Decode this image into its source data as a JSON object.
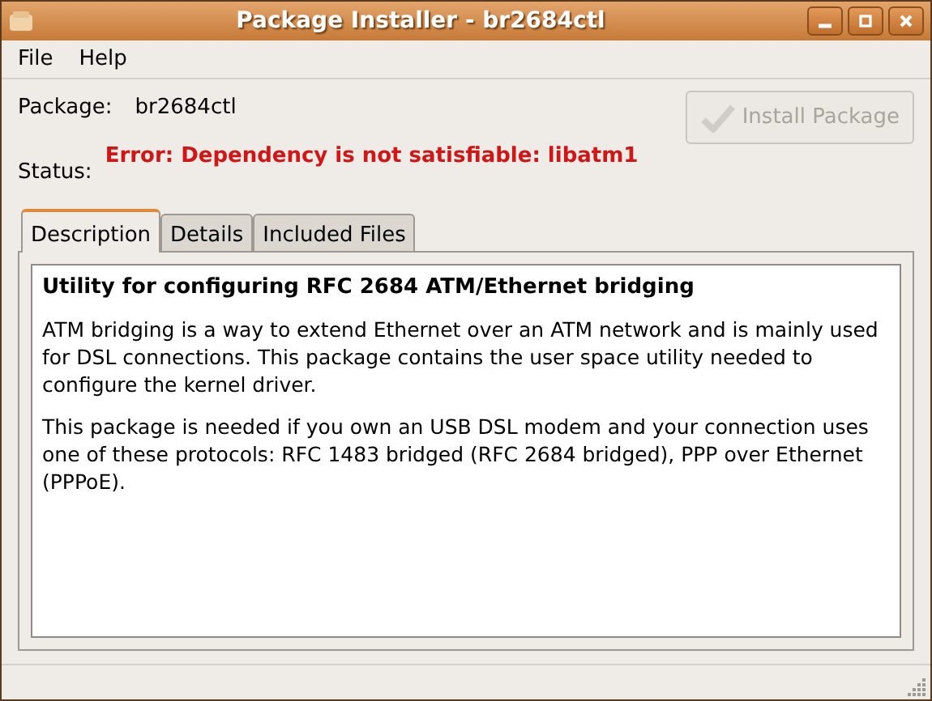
{
  "window": {
    "title": "Package Installer - br2684ctl"
  },
  "menu": [
    "File",
    "Help"
  ],
  "package": {
    "label": "Package:",
    "value": "br2684ctl"
  },
  "status": {
    "label": "Status:",
    "value": "Error: Dependency is not satisfiable: libatm1"
  },
  "install_button": {
    "label": "Install Package",
    "disabled": true
  },
  "tabs": [
    {
      "label": "Description",
      "selected": true
    },
    {
      "label": "Details",
      "selected": false
    },
    {
      "label": "Included Files",
      "selected": false
    }
  ],
  "description": {
    "heading": "Utility for configuring RFC 2684 ATM/Ethernet bridging",
    "paragraphs": [
      "ATM bridging is a way to extend Ethernet over an ATM network and is mainly used for DSL connections. This package contains the user space utility needed to configure the kernel driver.",
      "This package is needed if you own an USB DSL modem and your connection uses one of these protocols: RFC 1483 bridged (RFC 2684 bridged), PPP over Ethernet (PPPoE)."
    ]
  }
}
